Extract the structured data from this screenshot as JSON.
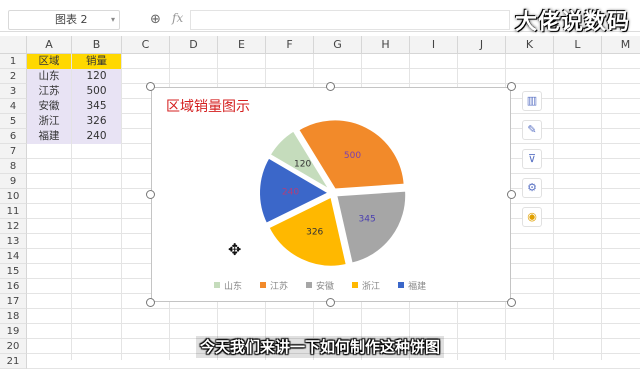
{
  "formula_bar": {
    "name_box": "图表 2",
    "zoom_icon": "zoom-icon",
    "fx_label": "fx"
  },
  "watermark": "大佬说数码",
  "columns": [
    "A",
    "B",
    "C",
    "D",
    "E",
    "F",
    "G",
    "H",
    "I",
    "J",
    "K",
    "L",
    "M"
  ],
  "rows": [
    "1",
    "2",
    "3",
    "4",
    "5",
    "6",
    "7",
    "8",
    "9",
    "10",
    "11",
    "12",
    "13",
    "14",
    "15",
    "16",
    "17",
    "18",
    "19",
    "20",
    "21"
  ],
  "table": {
    "header": [
      "区域",
      "销量"
    ],
    "rows": [
      [
        "山东",
        "120"
      ],
      [
        "江苏",
        "500"
      ],
      [
        "安徽",
        "345"
      ],
      [
        "浙江",
        "326"
      ],
      [
        "福建",
        "240"
      ]
    ]
  },
  "chart_data": {
    "type": "pie",
    "title": "区域销量图示",
    "categories": [
      "山东",
      "江苏",
      "安徽",
      "浙江",
      "福建"
    ],
    "values": [
      120,
      500,
      345,
      326,
      240
    ],
    "data_labels": [
      "120",
      "500",
      "345",
      "326",
      "240"
    ],
    "colors": [
      "#c5dcbc",
      "#f28a2a",
      "#a6a6a6",
      "#ffb800",
      "#3b67c9"
    ],
    "legend_position": "bottom"
  },
  "side_tools": [
    "chart-elements-icon",
    "style-brush-icon",
    "filter-icon",
    "settings-gear-icon",
    "lightbulb-icon"
  ],
  "subtitle": "今天我们来讲一下如何制作这种饼图"
}
